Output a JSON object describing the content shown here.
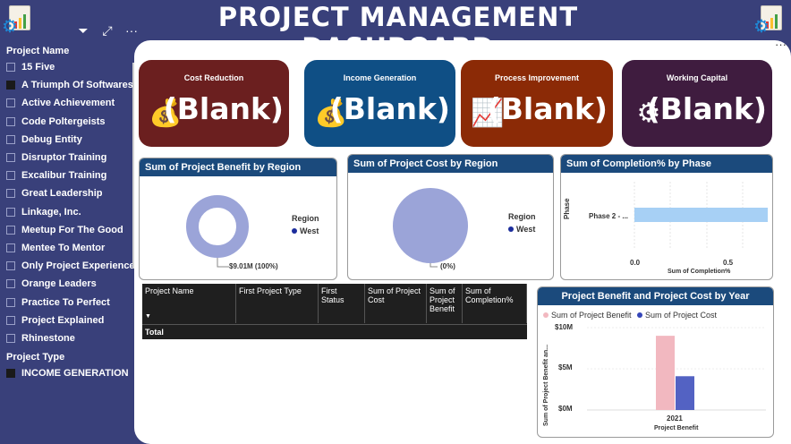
{
  "dashboard": {
    "title": "PROJECT MANAGEMENT DASHBOARD"
  },
  "toolbar": {
    "filter_icon": "filter-icon",
    "focus_icon": "focus-mode-icon",
    "more_icon": "more-options-icon",
    "more_label": "···"
  },
  "slicer_project_name": {
    "header": "Project Name",
    "items": [
      {
        "label": "15 Five",
        "checked": false
      },
      {
        "label": "A Triumph Of Softwares",
        "checked": true
      },
      {
        "label": "Active Achievement",
        "checked": false
      },
      {
        "label": "Code Poltergeists",
        "checked": false
      },
      {
        "label": "Debug Entity",
        "checked": false
      },
      {
        "label": "Disruptor Training",
        "checked": false
      },
      {
        "label": "Excalibur Training",
        "checked": false
      },
      {
        "label": "Great Leadership",
        "checked": false
      },
      {
        "label": "Linkage, Inc.",
        "checked": false
      },
      {
        "label": "Meetup For The Good",
        "checked": false
      },
      {
        "label": "Mentee To Mentor",
        "checked": false
      },
      {
        "label": "Only Project Experience",
        "checked": false
      },
      {
        "label": "Orange Leaders",
        "checked": false
      },
      {
        "label": "Practice To Perfect",
        "checked": false
      },
      {
        "label": "Project Explained",
        "checked": false
      },
      {
        "label": "Rhinestone",
        "checked": false
      }
    ]
  },
  "slicer_project_type": {
    "header": "Project Type",
    "items": [
      {
        "label": "INCOME GENERATION",
        "checked": true
      }
    ]
  },
  "kpis": [
    {
      "title": "Cost Reduction",
      "value": "(Blank)",
      "color": "#6b1f1f",
      "icon": "money-bag-chart-icon"
    },
    {
      "title": "Income Generation",
      "value": "(Blank)",
      "color": "#0f4f85",
      "icon": "hand-money-bag-icon"
    },
    {
      "title": "Process Improvement",
      "value": "(Blank)",
      "color": "#8b2a06",
      "icon": "growth-gear-chart-icon"
    },
    {
      "title": "Working Capital",
      "value": "(Blank)",
      "color": "#3f1c3f",
      "icon": "gear-coins-icon"
    }
  ],
  "donut_benefit": {
    "title": "Sum of Project Benefit by Region",
    "legend_title": "Region",
    "legend": [
      {
        "name": "West",
        "color": "#1c2d9c"
      }
    ],
    "data_label": "$9.01M (100%)"
  },
  "pie_cost": {
    "title": "Sum of Project Cost by Region",
    "legend_title": "Region",
    "legend": [
      {
        "name": "West",
        "color": "#1c2d9c"
      }
    ],
    "data_label": "(0%)"
  },
  "bar_completion": {
    "title": "Sum of Completion% by Phase",
    "y_axis_title": "Phase",
    "category": "Phase 2 - ...",
    "x_ticks": [
      "0.0",
      "0.5"
    ],
    "x_axis_title": "Sum of Completion%"
  },
  "table": {
    "columns": [
      "Project Name",
      "First Project Type",
      "First Status",
      "Sum of Project Cost",
      "Sum of Project Benefit",
      "Sum of Completion%"
    ],
    "total_label": "Total"
  },
  "column_chart": {
    "title": "Project Benefit and Project Cost by Year",
    "legend": [
      {
        "name": "Sum of  Project Benefit",
        "color": "#f2b8c0"
      },
      {
        "name": "Sum of  Project Cost",
        "color": "#3546b8"
      }
    ],
    "y_axis_title": "Sum of Project Benefit an...",
    "y_ticks": [
      "$10M",
      "$5M",
      "$0M"
    ],
    "x_category": "2021",
    "x_axis_title": "Project Benefit"
  },
  "chart_data": [
    {
      "type": "pie",
      "title": "Sum of Project Benefit by Region",
      "categories": [
        "West"
      ],
      "values": [
        9.01
      ],
      "unit": "$M",
      "donut": true
    },
    {
      "type": "pie",
      "title": "Sum of Project Cost by Region",
      "categories": [
        "West"
      ],
      "values": [
        0
      ]
    },
    {
      "type": "bar",
      "title": "Sum of Completion% by Phase",
      "categories": [
        "Phase 2 - ..."
      ],
      "values": [
        0.92
      ],
      "xlim": [
        0,
        1
      ]
    },
    {
      "type": "bar",
      "title": "Project Benefit and Project Cost by Year",
      "categories": [
        "2021"
      ],
      "series": [
        {
          "name": "Sum of  Project Benefit",
          "values": [
            9.01
          ]
        },
        {
          "name": "Sum of  Project Cost",
          "values": [
            4.1
          ]
        }
      ],
      "ylim": [
        0,
        10
      ],
      "unit": "$M"
    }
  ]
}
